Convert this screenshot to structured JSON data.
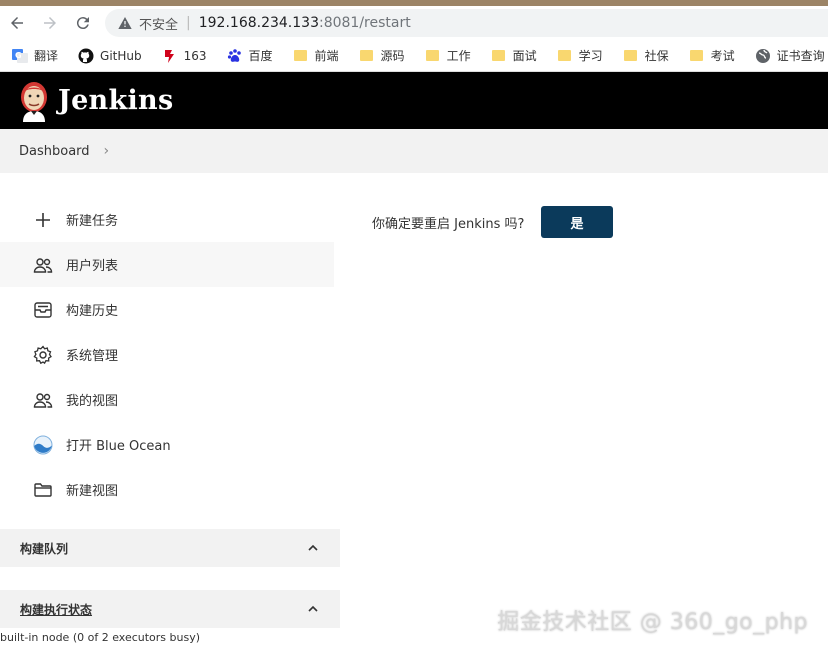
{
  "browser": {
    "insecure_label": "不安全",
    "url_host": "192.168.234.133",
    "url_path": ":8081/restart"
  },
  "bookmarks": [
    {
      "label": "翻译",
      "icon": "translate-icon"
    },
    {
      "label": "GitHub",
      "icon": "github-icon"
    },
    {
      "label": "163",
      "icon": "netease-icon"
    },
    {
      "label": "百度",
      "icon": "baidu-icon"
    },
    {
      "label": "前端",
      "icon": "folder-icon"
    },
    {
      "label": "源码",
      "icon": "folder-icon"
    },
    {
      "label": "工作",
      "icon": "folder-icon"
    },
    {
      "label": "面试",
      "icon": "folder-icon"
    },
    {
      "label": "学习",
      "icon": "folder-icon"
    },
    {
      "label": "社保",
      "icon": "folder-icon"
    },
    {
      "label": "考试",
      "icon": "folder-icon"
    },
    {
      "label": "证书查询",
      "icon": "globe-icon"
    }
  ],
  "header": {
    "title": "Jenkins"
  },
  "breadcrumbs": {
    "dashboard": "Dashboard"
  },
  "sidebar": {
    "tasks": [
      {
        "label": "新建任务",
        "icon": "plus-icon"
      },
      {
        "label": "用户列表",
        "icon": "users-icon"
      },
      {
        "label": "构建历史",
        "icon": "history-icon"
      },
      {
        "label": "系统管理",
        "icon": "gear-icon"
      },
      {
        "label": "我的视图",
        "icon": "users-icon"
      },
      {
        "label": "打开 Blue Ocean",
        "icon": "blue-ocean-icon"
      },
      {
        "label": "新建视图",
        "icon": "folder-icon"
      }
    ],
    "queue_title": "构建队列",
    "executors_title": "构建执行状态",
    "executors_status": "built-in node (0 of 2 executors busy)"
  },
  "main": {
    "question": "你确定要重启 Jenkins 吗?",
    "yes_label": "是"
  },
  "watermark": "掘金技术社区 @ 360_go_php",
  "colors": {
    "header_bg": "#000000",
    "button_bg": "#0b3a5b"
  }
}
